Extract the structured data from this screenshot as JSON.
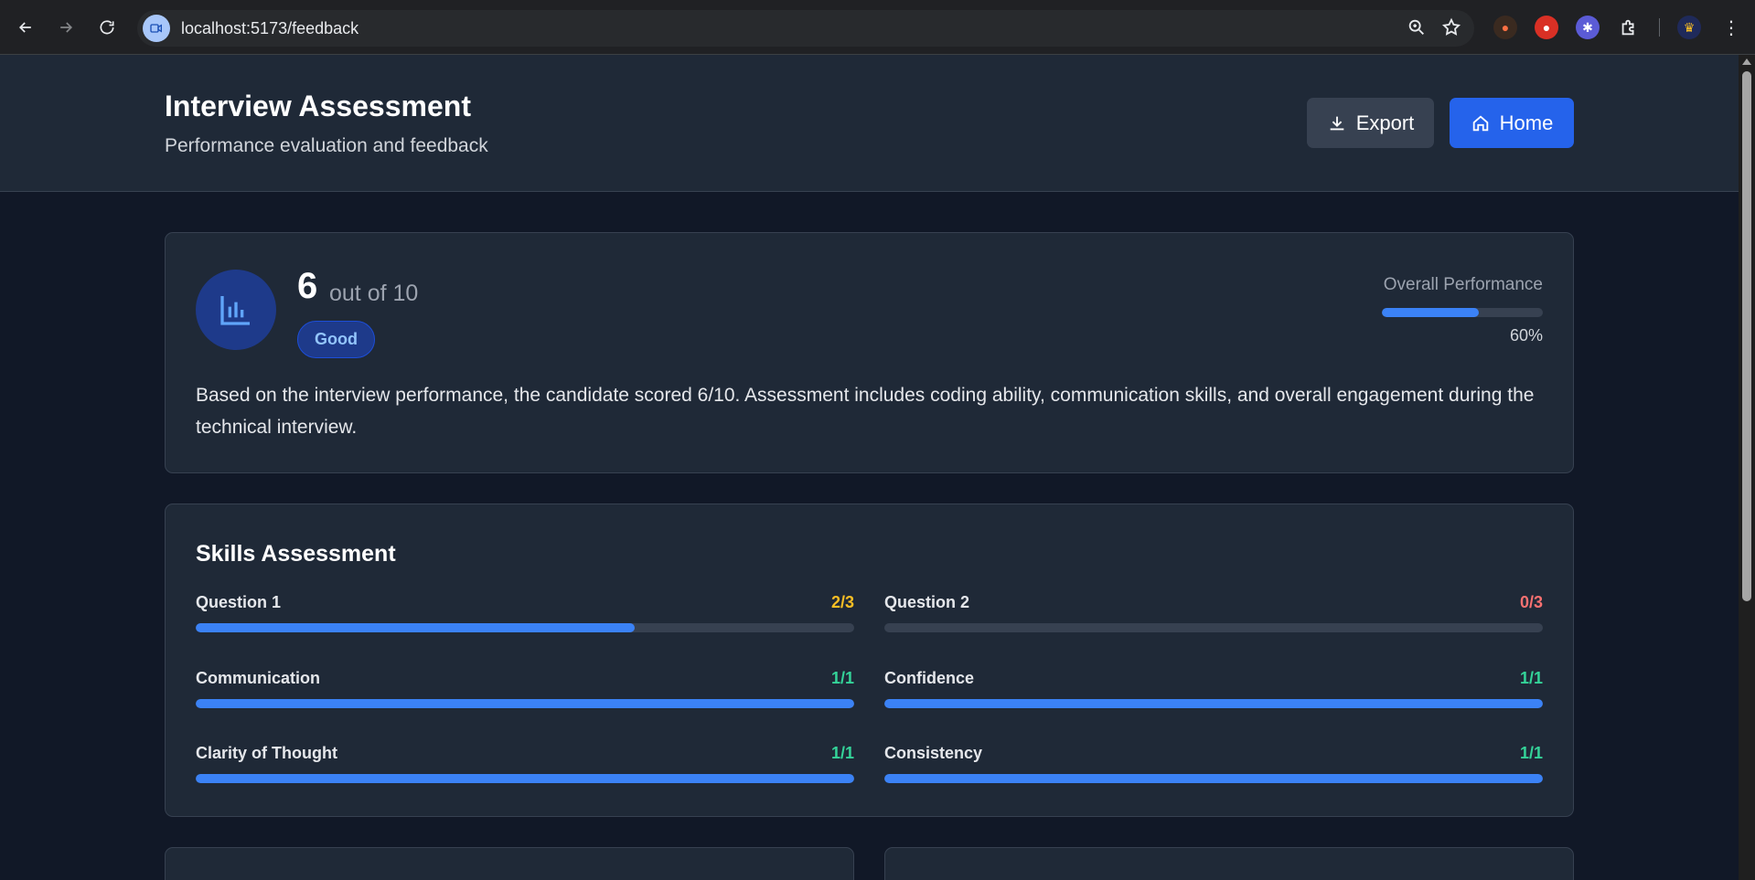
{
  "browser": {
    "url": "localhost:5173/feedback"
  },
  "header": {
    "title": "Interview Assessment",
    "subtitle": "Performance evaluation and feedback",
    "export_label": "Export",
    "home_label": "Home"
  },
  "score": {
    "value": "6",
    "out_of": "out of 10",
    "badge": "Good",
    "overall_label": "Overall Performance",
    "overall_percent": 60,
    "overall_percent_text": "60%",
    "summary": "Based on the interview performance, the candidate scored 6/10. Assessment includes coding ability, communication skills, and overall engagement during the technical interview."
  },
  "skills": {
    "title": "Skills Assessment",
    "items": [
      {
        "name": "Question 1",
        "score": "2/3",
        "fraction": 0.6667,
        "color": "#fbbf24"
      },
      {
        "name": "Question 2",
        "score": "0/3",
        "fraction": 0,
        "color": "#f87171"
      },
      {
        "name": "Communication",
        "score": "1/1",
        "fraction": 1,
        "color": "#34d399"
      },
      {
        "name": "Confidence",
        "score": "1/1",
        "fraction": 1,
        "color": "#34d399"
      },
      {
        "name": "Clarity of Thought",
        "score": "1/1",
        "fraction": 1,
        "color": "#34d399"
      },
      {
        "name": "Consistency",
        "score": "1/1",
        "fraction": 1,
        "color": "#34d399"
      }
    ]
  },
  "colors": {
    "accent": "#3b82f6",
    "background": "#111827",
    "card": "#1f2937"
  }
}
